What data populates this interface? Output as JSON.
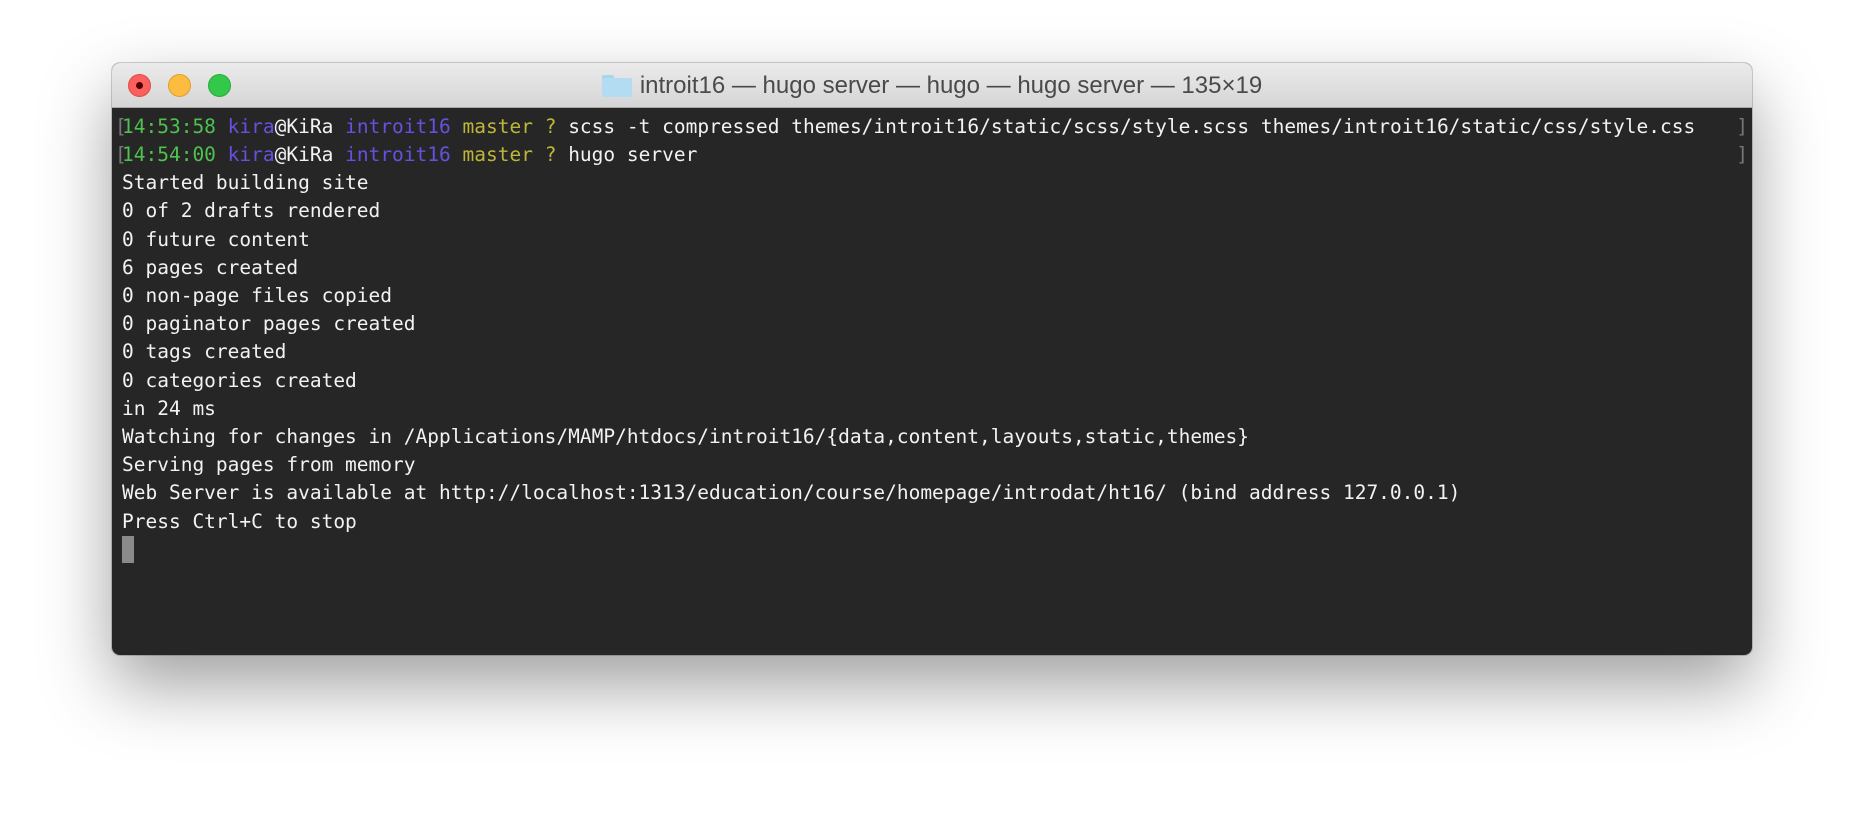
{
  "window": {
    "title": "introit16 — hugo server — hugo — hugo server — 135×19",
    "icon": "folder-icon"
  },
  "colors": {
    "time": "#4ec24e",
    "user": "#6352e0",
    "branch": "#bdb639",
    "background": "#262626"
  },
  "prompts": [
    {
      "time": "14:53:58",
      "user": "kira",
      "host": "@KiRa",
      "dir": "introit16",
      "branch": "master ?",
      "command": "scss -t compressed themes/introit16/static/scss/style.scss themes/introit16/static/css/style.css"
    },
    {
      "time": "14:54:00",
      "user": "kira",
      "host": "@KiRa",
      "dir": "introit16",
      "branch": "master ?",
      "command": "hugo server"
    }
  ],
  "output": [
    "Started building site",
    "0 of 2 drafts rendered",
    "0 future content",
    "6 pages created",
    "0 non-page files copied",
    "0 paginator pages created",
    "0 tags created",
    "0 categories created",
    "in 24 ms",
    "Watching for changes in /Applications/MAMP/htdocs/introit16/{data,content,layouts,static,themes}",
    "Serving pages from memory",
    "Web Server is available at http://localhost:1313/education/course/homepage/introdat/ht16/ (bind address 127.0.0.1)",
    "Press Ctrl+C to stop"
  ],
  "brackets": {
    "open": "[",
    "close": "]"
  }
}
